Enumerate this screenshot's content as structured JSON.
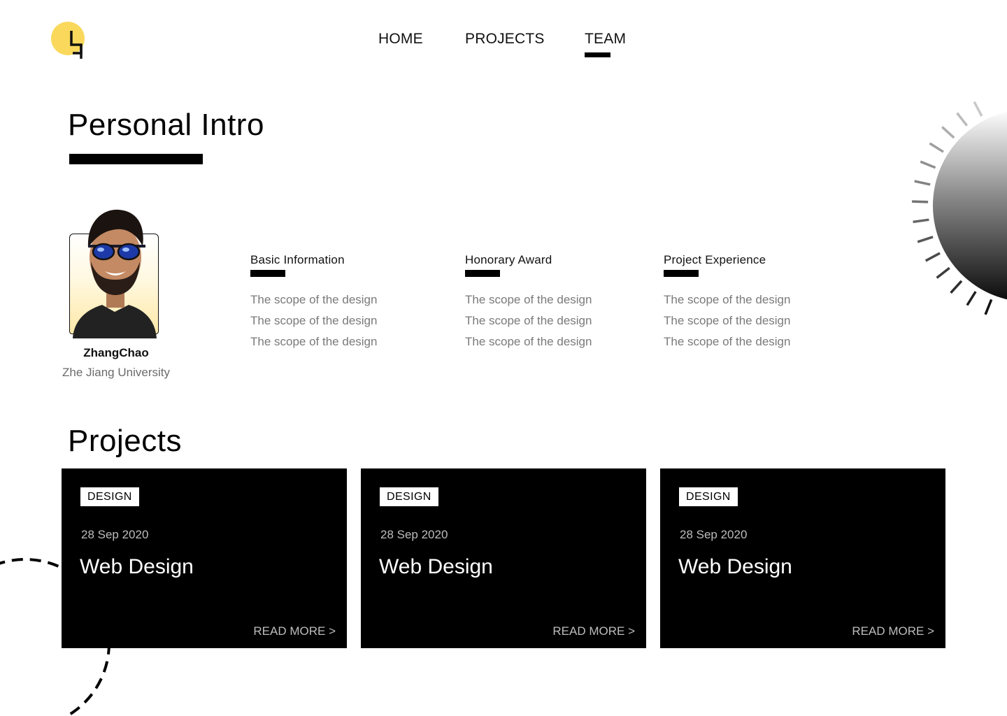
{
  "nav": {
    "home": "HOME",
    "projects": "PROJECTS",
    "team": "TEAM",
    "active": "TEAM"
  },
  "colors": {
    "accent_yellow": "#f9d85c",
    "card_background": "#000000",
    "muted_text": "#7a7a7a"
  },
  "intro": {
    "title": "Personal Intro",
    "person": {
      "name": "ZhangChao",
      "school": "Zhe Jiang University"
    },
    "columns": [
      {
        "title": "Basic Information",
        "lines": [
          "The scope of the design",
          "The scope of the design",
          "The scope of the design"
        ]
      },
      {
        "title": "Honorary Award",
        "lines": [
          "The scope of the design",
          "The scope of the design",
          "The scope of the design"
        ]
      },
      {
        "title": "Project Experience",
        "lines": [
          "The scope of the design",
          "The scope of the design",
          "The scope of the design"
        ]
      }
    ]
  },
  "projects": {
    "title": "Projects",
    "cards": [
      {
        "tag": "DESIGN",
        "date": "28 Sep 2020",
        "title": "Web Design",
        "read_more": "READ MORE >"
      },
      {
        "tag": "DESIGN",
        "date": "28 Sep 2020",
        "title": "Web Design",
        "read_more": "READ MORE >"
      },
      {
        "tag": "DESIGN",
        "date": "28 Sep 2020",
        "title": "Web Design",
        "read_more": "READ MORE >"
      }
    ]
  }
}
